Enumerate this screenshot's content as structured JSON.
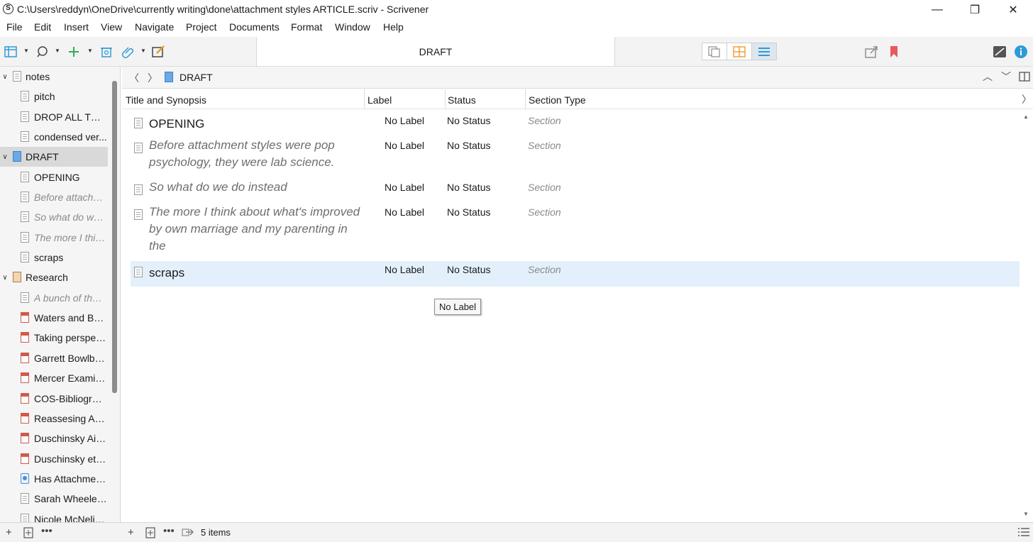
{
  "window": {
    "title": "C:\\Users\\reddyn\\OneDrive\\currently writing\\done\\attachment styles ARTICLE.scriv - Scrivener",
    "app_icon": "S",
    "controls": {
      "minimize": "—",
      "maximize": "❐",
      "close": "✕"
    }
  },
  "menu": [
    "File",
    "Edit",
    "Insert",
    "View",
    "Navigate",
    "Project",
    "Documents",
    "Format",
    "Window",
    "Help"
  ],
  "toolbar": {
    "document_title": "DRAFT",
    "icons": [
      "binder-toggle-icon",
      "search-icon",
      "add-icon",
      "trash-icon",
      "attachment-icon",
      "compose-icon",
      "share-icon",
      "bookmark-icon",
      "inspector-toggle-icon",
      "info-icon"
    ],
    "accent_color": "#2e9ad8",
    "add_color": "#2fb04f",
    "bookmark_color": "#e8595b",
    "corkboard_color": "#f0a040"
  },
  "binder": {
    "items": [
      {
        "label": "notes",
        "icon": "folder-doc",
        "level": 0,
        "expanded": true
      },
      {
        "label": "pitch",
        "icon": "doc",
        "level": 1
      },
      {
        "label": "DROP ALL THE ...",
        "icon": "doc",
        "level": 1
      },
      {
        "label": "condensed ver...",
        "icon": "doc",
        "level": 1
      },
      {
        "label": "DRAFT",
        "icon": "draft",
        "level": 0,
        "expanded": true,
        "selected": true
      },
      {
        "label": "OPENING",
        "icon": "doc",
        "level": 1
      },
      {
        "label": "Before attachm...",
        "icon": "doc",
        "level": 1,
        "italic": true
      },
      {
        "label": "So what do we ...",
        "icon": "doc",
        "level": 1,
        "italic": true
      },
      {
        "label": "The more I thin...",
        "icon": "doc",
        "level": 1,
        "italic": true
      },
      {
        "label": "scraps",
        "icon": "doc",
        "level": 1
      },
      {
        "label": "Research",
        "icon": "research",
        "level": 0,
        "expanded": true
      },
      {
        "label": "A bunch of the ...",
        "icon": "doc",
        "level": 1,
        "italic": true
      },
      {
        "label": "Waters and Bea...",
        "icon": "pdf",
        "level": 1
      },
      {
        "label": "Taking perspec...",
        "icon": "pdf",
        "level": 1
      },
      {
        "label": "Garrett Bowlby ...",
        "icon": "pdf",
        "level": 1
      },
      {
        "label": "Mercer Examini...",
        "icon": "pdf",
        "level": 1
      },
      {
        "label": "COS-Bibliograp...",
        "icon": "pdf",
        "level": 1
      },
      {
        "label": "Reassesing Att...",
        "icon": "pdf",
        "level": 1
      },
      {
        "label": "Duschinsky Ain...",
        "icon": "pdf",
        "level": 1
      },
      {
        "label": "Duschinsky et a...",
        "icon": "pdf",
        "level": 1
      },
      {
        "label": "Has Attachmen...",
        "icon": "web",
        "level": 1
      },
      {
        "label": "Sarah Wheeler ...",
        "icon": "doc",
        "level": 1
      },
      {
        "label": "Nicole McNelis...",
        "icon": "doc",
        "level": 1
      }
    ],
    "footer_icons": [
      "add-icon",
      "add-folder-icon",
      "more-icon"
    ]
  },
  "editor": {
    "breadcrumb": "DRAFT",
    "columns": {
      "title": "Title and Synopsis",
      "label": "Label",
      "status": "Status",
      "section_type": "Section Type"
    },
    "rows": [
      {
        "title": "OPENING",
        "italic": false,
        "label": "No Label",
        "status": "No Status",
        "section_type": "Section"
      },
      {
        "title": "Before attachment styles were pop psychology, they were lab science.",
        "italic": true,
        "label": "No Label",
        "status": "No Status",
        "section_type": "Section"
      },
      {
        "title": "So what do we do instead",
        "italic": true,
        "label": "No Label",
        "status": "No Status",
        "section_type": "Section"
      },
      {
        "title": "The more I think about what's improved by own marriage and my parenting in the",
        "italic": true,
        "label": "No Label",
        "status": "No Status",
        "section_type": "Section"
      },
      {
        "title": "scraps",
        "italic": false,
        "label": "No Label",
        "status": "No Status",
        "section_type": "Section",
        "selected": true
      }
    ],
    "tooltip": "No Label",
    "footer": {
      "item_count": "5 items"
    }
  }
}
